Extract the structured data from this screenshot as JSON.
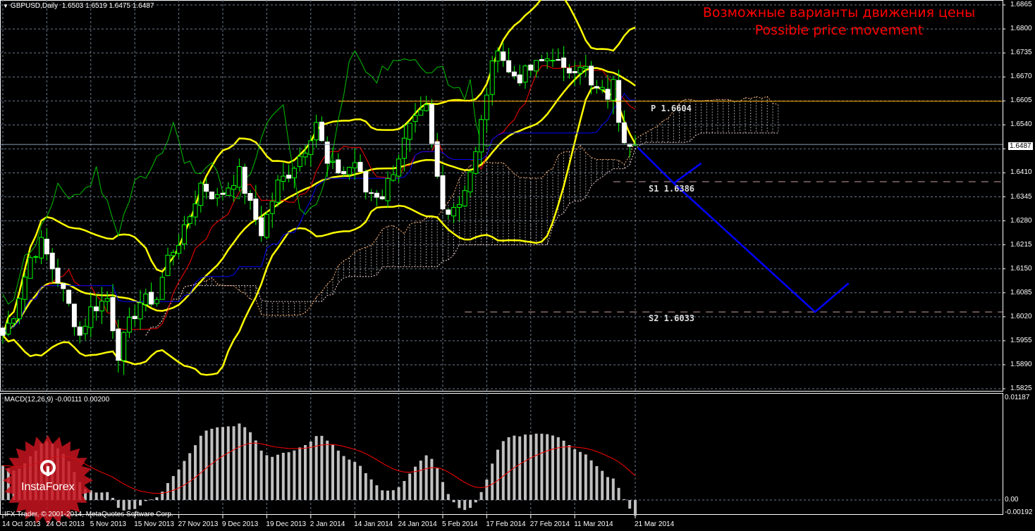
{
  "header": {
    "symbol": "GBPUSD,Daily",
    "ohlc": "1.6503 1.6519 1.6475 1.6487"
  },
  "annotation": {
    "title_ru": "Возможные варианты движения цены",
    "title_en": "Possible price movement"
  },
  "pivots": {
    "p_label": "P 1.6604",
    "s1_label": "S1 1.6386",
    "s2_label": "S2 1.6033"
  },
  "current_price": "1.6487",
  "macd": {
    "label": "MACD(12,26,9) -0.00111 0.00200"
  },
  "footer": {
    "copyright": "IFX Trader, © 2001-2014, MetaQuotes Software Corp."
  },
  "watermark": {
    "brand": "InstaForex"
  },
  "colors": {
    "candle": "#ffffff",
    "wick": "#00ff00",
    "bollinger": "#ffff00",
    "tenkan": "#ff0000",
    "kijun": "#0000ff",
    "chikou": "#00c000",
    "forecast": "#0000ff",
    "grid": "#6b7a8c",
    "pivot": "#ffb000"
  },
  "chart_data": {
    "type": "candlestick",
    "title": "GBPUSD,Daily",
    "ylim": [
      1.5825,
      1.6865
    ],
    "y_ticks": [
      "1.6865",
      "1.6800",
      "1.6735",
      "1.6670",
      "1.6605",
      "1.6540",
      "1.6475",
      "1.6410",
      "1.6345",
      "1.6280",
      "1.6215",
      "1.6150",
      "1.6085",
      "1.6020",
      "1.5955",
      "1.5890",
      "1.5825"
    ],
    "x_ticks": [
      {
        "bar": 0,
        "label": "14 Oct 2013"
      },
      {
        "bar": 8,
        "label": "24 Oct 2013"
      },
      {
        "bar": 16,
        "label": "5 Nov 2013"
      },
      {
        "bar": 24,
        "label": "15 Nov 2013"
      },
      {
        "bar": 32,
        "label": "27 Nov 2013"
      },
      {
        "bar": 40,
        "label": "9 Dec 2013"
      },
      {
        "bar": 48,
        "label": "19 Dec 2013"
      },
      {
        "bar": 56,
        "label": "2 Jan 2014"
      },
      {
        "bar": 64,
        "label": "14 Jan 2014"
      },
      {
        "bar": 72,
        "label": "24 Jan 2014"
      },
      {
        "bar": 80,
        "label": "5 Feb 2014"
      },
      {
        "bar": 88,
        "label": "17 Feb 2014"
      },
      {
        "bar": 96,
        "label": "27 Feb 2014"
      },
      {
        "bar": 104,
        "label": "11 Mar 2014"
      },
      {
        "bar": 115,
        "label": "21 Mar 2014"
      }
    ],
    "close_keypoints": [
      [
        0,
        1.597
      ],
      [
        2,
        1.603
      ],
      [
        5,
        1.618
      ],
      [
        7,
        1.622
      ],
      [
        10,
        1.612
      ],
      [
        12,
        1.605
      ],
      [
        14,
        1.597
      ],
      [
        16,
        1.604
      ],
      [
        19,
        1.607
      ],
      [
        21,
        1.592
      ],
      [
        23,
        1.6
      ],
      [
        25,
        1.606
      ],
      [
        28,
        1.607
      ],
      [
        30,
        1.618
      ],
      [
        33,
        1.625
      ],
      [
        36,
        1.638
      ],
      [
        39,
        1.634
      ],
      [
        43,
        1.641
      ],
      [
        45,
        1.632
      ],
      [
        47,
        1.625
      ],
      [
        50,
        1.638
      ],
      [
        52,
        1.641
      ],
      [
        55,
        1.648
      ],
      [
        57,
        1.655
      ],
      [
        59,
        1.643
      ],
      [
        62,
        1.641
      ],
      [
        64,
        1.644
      ],
      [
        66,
        1.636
      ],
      [
        69,
        1.635
      ],
      [
        71,
        1.642
      ],
      [
        74,
        1.653
      ],
      [
        77,
        1.658
      ],
      [
        78,
        1.648
      ],
      [
        80,
        1.631
      ],
      [
        83,
        1.633
      ],
      [
        86,
        1.646
      ],
      [
        88,
        1.663
      ],
      [
        90,
        1.676
      ],
      [
        92,
        1.668
      ],
      [
        94,
        1.667
      ],
      [
        97,
        1.67
      ],
      [
        100,
        1.673
      ],
      [
        102,
        1.668
      ],
      [
        105,
        1.671
      ],
      [
        106,
        1.669
      ],
      [
        107,
        1.664
      ],
      [
        110,
        1.662
      ],
      [
        111,
        1.665
      ],
      [
        112,
        1.656
      ],
      [
        113,
        1.651
      ],
      [
        115,
        1.6487
      ]
    ],
    "pivot_levels": {
      "P": 1.6604,
      "S1": 1.6386,
      "S2": 1.6033
    },
    "forecast_paths": [
      [
        [
          115.5,
          1.6478
        ],
        [
          122,
          1.6382
        ],
        [
          127,
          1.6436
        ]
      ],
      [
        [
          122,
          1.6382
        ],
        [
          147.7,
          1.6033
        ],
        [
          153.8,
          1.6111
        ]
      ]
    ],
    "macd_ylim": [
      -0.00192,
      0.01187
    ],
    "macd_ticks": [
      "0.01187",
      "0.00",
      "-0.00192"
    ]
  }
}
